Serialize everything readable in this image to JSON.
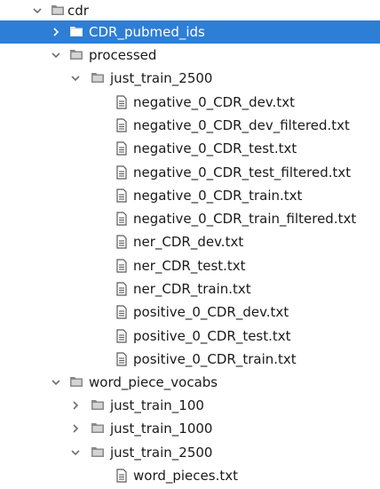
{
  "tree": {
    "root_label": "cdr",
    "pubmed_label": "CDR_pubmed_ids",
    "processed_label": "processed",
    "processed_just_train_label": "just_train_2500",
    "files": [
      "negative_0_CDR_dev.txt",
      "negative_0_CDR_dev_filtered.txt",
      "negative_0_CDR_test.txt",
      "negative_0_CDR_test_filtered.txt",
      "negative_0_CDR_train.txt",
      "negative_0_CDR_train_filtered.txt",
      "ner_CDR_dev.txt",
      "ner_CDR_test.txt",
      "ner_CDR_train.txt",
      "positive_0_CDR_dev.txt",
      "positive_0_CDR_test.txt",
      "positive_0_CDR_train.txt"
    ],
    "vocabs_label": "word_piece_vocabs",
    "vocabs_children": [
      "just_train_100",
      "just_train_1000",
      "just_train_2500"
    ],
    "vocab_file": "word_pieces.txt"
  },
  "colors": {
    "selection": "#2e7ed6",
    "text": "#1a1a1a",
    "chevron": "#6e6e6e",
    "folder_icon": "#8a8a8a",
    "file_icon": "#5a5a5a"
  },
  "icons": {
    "expanded": "chevron-down-icon",
    "collapsed": "chevron-right-icon",
    "folder": "folder-icon",
    "file": "text-file-icon"
  }
}
